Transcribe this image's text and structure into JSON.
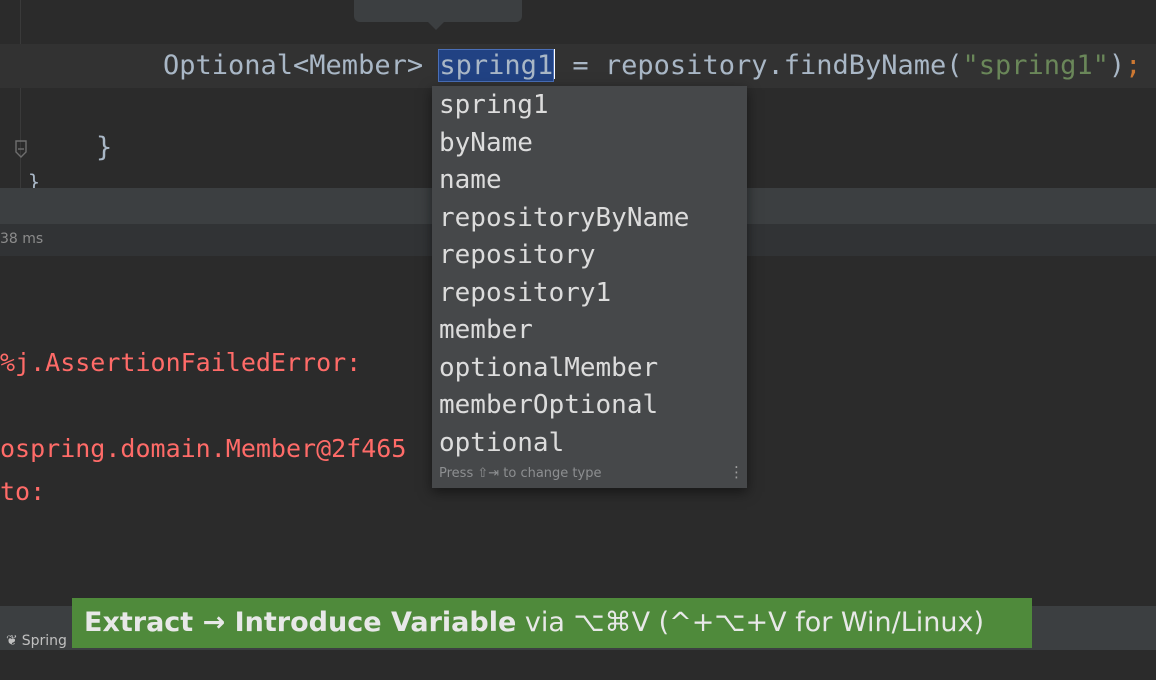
{
  "editor": {
    "code": {
      "type": "Optional<Member> ",
      "variable": "spring1",
      "assign": " = repository.findByName(",
      "string_literal": "\"spring1\"",
      "close": ")",
      "semicolon": ";"
    },
    "closing_brace": "}",
    "outer_brace": "}"
  },
  "run_panel": {
    "timing": "38 ms"
  },
  "console": {
    "lines": [
      "%j.AssertionFailedError:",
      "ospring.domain.Member@2f465",
      "to:"
    ]
  },
  "completion_popup": {
    "items": [
      "spring1",
      "byName",
      "name",
      "repositoryByName",
      "repository",
      "repository1",
      "member",
      "optionalMember",
      "memberOptional",
      "optional"
    ],
    "hint": "Press ⇧⇥ to change type",
    "more_icon": "⋮"
  },
  "bottom_bar": {
    "tab_label": "Spring"
  },
  "banner": {
    "action": "Extract → Introduce Variable",
    "shortcut": " via ⌥⌘V (^+⌥+V for Win/Linux)"
  },
  "colors": {
    "background": "#2b2b2b",
    "popup": "#46484a",
    "error": "#ff6b68",
    "banner": "#4f8a3b",
    "selection": "#214283"
  }
}
